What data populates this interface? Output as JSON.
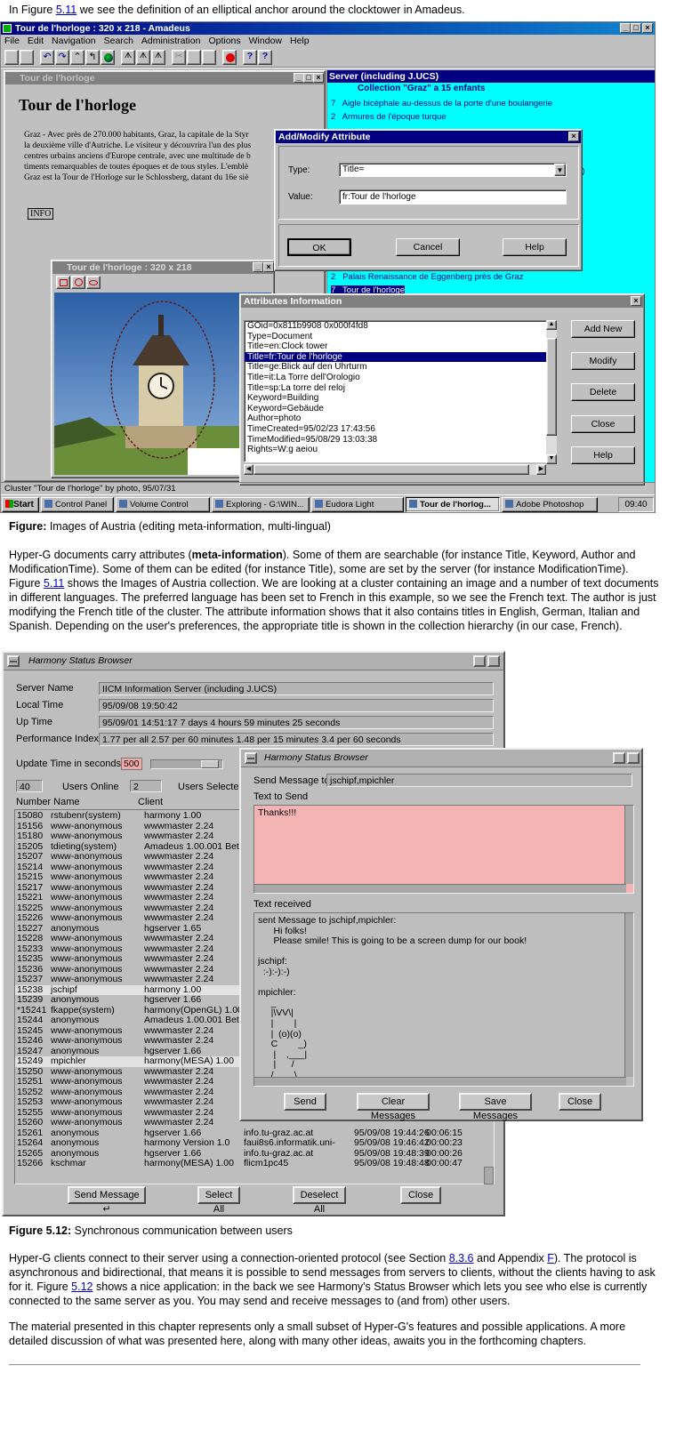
{
  "intro": {
    "before": "In Figure ",
    "link": "5.11",
    "after": " we see the definition of an elliptical anchor around the clocktower in Amadeus."
  },
  "fig1": {
    "title": "Tour de l'horloge :  320 x 218 - Amadeus",
    "menus": [
      "File",
      "Edit",
      "Navigation",
      "Search",
      "Administration",
      "Options",
      "Window",
      "Help"
    ],
    "doc": {
      "title": "Tour de l'horloge",
      "heading": "Tour de l'horloge",
      "lines": [
        "Graz - Avec près de 270.000 habitants, Graz, la capitale de la Styr",
        "la deuxième ville d'Autriche. Le visiteur y découvrira l'un des plus",
        "centres urbains anciens d'Europe centrale, avec une multitude de b",
        "timents remarquables de toutes époques et de tous styles. L'emblè",
        "Graz est la Tour de l'Horloge sur le Schlossberg, datant du 16e siè"
      ],
      "info": "INFO"
    },
    "server": {
      "title": "Server (including J.UCS)",
      "collection": "Collection \"Graz\" a 15 enfants",
      "items": [
        "7   Aigle bicéphale au-dessus de la porte d'une boulangerie",
        "2   Armures de l'époque turque"
      ],
      "partial": "g)",
      "items2": [
        "2   Palais Renaissance de Eggenberg près de Graz",
        "7   Tour de l'horloge"
      ]
    },
    "dialog": {
      "title": "Add/Modify Attribute",
      "type_label": "Type:",
      "type_value": "Title=",
      "value_label": "Value:",
      "value_value": "fr:Tour de l'horloge",
      "ok": "OK",
      "cancel": "Cancel",
      "help": "Help"
    },
    "image_win": {
      "title": "Tour de l'horloge :  320 x 218"
    },
    "attrs": {
      "title": "Attributes Information",
      "items": [
        "GOid=0x811b9908 0x000f4fd8",
        "Type=Document",
        "Title=en:Clock tower",
        "Title=fr:Tour de l'horloge",
        "Title=ge:Blick auf den Uhrturm",
        "Title=it:La Torre dell'Orologio",
        "Title=sp:La torre del reloj",
        "Keyword=Building",
        "Keyword=Gebäude",
        "Author=photo",
        "TimeCreated=95/02/23 17:43:56",
        "TimeModified=95/08/29 13:03:38",
        "Rights=W:g aeiou"
      ],
      "selected": 3,
      "buttons": [
        "Add New",
        "Modify",
        "Delete",
        "Close",
        "Help"
      ]
    },
    "status": "Cluster \"Tour de l'horloge\" by photo, 95/07/31",
    "taskbar": {
      "start": "Start",
      "items": [
        "Control Panel",
        "Volume Control",
        "Exploring - G:\\WIN...",
        "Eudora Light",
        "Tour de l'horlog...",
        "Adobe Photoshop"
      ],
      "active": 4,
      "clock": "09:40"
    }
  },
  "caption1": {
    "bold": "Figure:",
    "text": " Images of Austria (editing meta-information, multi-lingual)"
  },
  "para1": {
    "a": "Hyper-G documents carry attributes (",
    "bold": "meta-information",
    "b": "). Some of them are searchable (for instance Title, Keyword, Author and ModificationTime). Some of them can be edited (for instance Title), some are set by the server (for instance ModificationTime). Figure ",
    "link": "5.11",
    "c": " shows the Images of Austria collection. We are looking at a cluster containing an image and a number of text documents in different languages. The preferred language has been set to French in this example, so we see the French text. The author is just modifying the French title of the cluster. The attribute information shows that it also contains titles in English, German, Italian and Spanish. Depending on the user's preferences, the appropriate title is shown in the collection hierarchy (in our case, French)."
  },
  "fig2": {
    "title": "Harmony Status Browser",
    "fields": [
      {
        "label": "Server Name",
        "value": "IICM Information Server (including J.UCS)"
      },
      {
        "label": "Local Time",
        "value": "95/09/08 19:50:42"
      },
      {
        "label": "Up Time",
        "value": "95/09/01 14:51:17    7 days 4 hours 59 minutes 25 seconds"
      },
      {
        "label": "Performance Index",
        "value": "1.77 per all 2.57 per 60 minutes 1.48 per 15 minutes 3.4 per 60 seconds"
      }
    ],
    "update_label": "Update Time in seconds",
    "update_value": "500",
    "users_online": "40",
    "users_online_label": "Users Online",
    "users_selected": "2",
    "users_selected_label": "Users Selected",
    "col_num": "Number Name",
    "col_client": "Client",
    "users": [
      [
        "15080",
        "rstubenr(system)",
        "harmony 1.00"
      ],
      [
        "15156",
        "www-anonymous",
        "wwwmaster 2.24"
      ],
      [
        "15180",
        "www-anonymous",
        "wwwmaster 2.24"
      ],
      [
        "15205",
        "tdieting(system)",
        "Amadeus 1.00.001 Beta"
      ],
      [
        "15207",
        "www-anonymous",
        "wwwmaster 2.24"
      ],
      [
        "15214",
        "www-anonymous",
        "wwwmaster 2.24"
      ],
      [
        "15215",
        "www-anonymous",
        "wwwmaster 2.24"
      ],
      [
        "15217",
        "www-anonymous",
        "wwwmaster 2.24"
      ],
      [
        "15221",
        "www-anonymous",
        "wwwmaster 2.24"
      ],
      [
        "15225",
        "www-anonymous",
        "wwwmaster 2.24"
      ],
      [
        "15226",
        "www-anonymous",
        "wwwmaster 2.24"
      ],
      [
        "15227",
        "anonymous",
        "hgserver 1.65"
      ],
      [
        "15228",
        "www-anonymous",
        "wwwmaster 2.24"
      ],
      [
        "15233",
        "www-anonymous",
        "wwwmaster 2.24"
      ],
      [
        "15235",
        "www-anonymous",
        "wwwmaster 2.24"
      ],
      [
        "15236",
        "www-anonymous",
        "wwwmaster 2.24"
      ],
      [
        "15237",
        "www-anonymous",
        "wwwmaster 2.24"
      ],
      [
        "15238",
        "jschipf",
        "harmony 1.00"
      ],
      [
        "15239",
        "anonymous",
        "hgserver 1.66"
      ],
      [
        "*15241",
        "fkappe(system)",
        "harmony(OpenGL) 1.00"
      ],
      [
        "15244",
        "anonymous",
        "Amadeus 1.00.001 Beta"
      ],
      [
        "15245",
        "www-anonymous",
        "wwwmaster 2.24"
      ],
      [
        "15246",
        "www-anonymous",
        "wwwmaster 2.24"
      ],
      [
        "15247",
        "anonymous",
        "hgserver 1.66"
      ],
      [
        "15249",
        "mpichler",
        "harmony(MESA) 1.00"
      ],
      [
        "15250",
        "www-anonymous",
        "wwwmaster 2.24"
      ],
      [
        "15251",
        "www-anonymous",
        "wwwmaster 2.24"
      ],
      [
        "15252",
        "www-anonymous",
        "wwwmaster 2.24"
      ],
      [
        "15253",
        "www-anonymous",
        "wwwmaster 2.24"
      ],
      [
        "15255",
        "www-anonymous",
        "wwwmaster 2.24"
      ],
      [
        "15260",
        "www-anonymous",
        "wwwmaster 2.24"
      ],
      [
        "15261",
        "anonymous",
        "hgserver 1.66",
        "info.tu-graz.ac.at",
        "95/09/08  19:44:26",
        "00:06:15"
      ],
      [
        "15264",
        "anonymous",
        "harmony Version 1.0",
        "faui8s6.informatik.uni-",
        "95/09/08  19:46:42",
        "00:00:23"
      ],
      [
        "15265",
        "anonymous",
        "hgserver 1.66",
        "info.tu-graz.ac.at",
        "95/09/08  19:48:39",
        "00:00:26"
      ],
      [
        "15266",
        "kschmar",
        "harmony(MESA) 1.00",
        "flicm1pc45",
        "95/09/08  19:48:48",
        "00:00:47"
      ]
    ],
    "highlight": [
      17,
      24
    ],
    "buttons": [
      "Send Message ↵",
      "Select All",
      "Deselect All",
      "Close"
    ],
    "msg": {
      "title": "Harmony Status Browser",
      "send_to_label": "Send Message to",
      "send_to_value": "jschipf,mpichler",
      "text_to_send_label": "Text to Send",
      "text_to_send": "Thanks!!!",
      "received_label": "Text received",
      "received": [
        "sent Message to jschipf,mpichler:",
        "      Hi folks!",
        "      Please smile! This is going to be a screen dump for our book!",
        "",
        "jschipf:",
        "  :-):-):-)",
        "",
        "mpichler:",
        "     _",
        "     |\\VV\\|",
        "     |        |",
        "     |  (o)(o)",
        "     C        _)",
        "      |    ,___|",
        "      |      /",
        "     /____\\"
      ],
      "buttons": [
        "Send",
        "Clear Messages",
        "Save Messages",
        "Close"
      ]
    }
  },
  "caption2": {
    "bold": "Figure 5.12:",
    "text": " Synchronous communication between users"
  },
  "para2": {
    "a": "Hyper-G clients connect to their server using a connection-oriented protocol (see Section ",
    "link1": "8.3.6",
    "b": " and Appendix ",
    "link2": "F",
    "c": "). The protocol is asynchronous and bidirectional, that means it is possible to send messages from servers to clients, without the clients having to ask for it. Figure ",
    "link3": "5.12",
    "d": " shows a nice application: in the back we see Harmony's Status Browser which lets you see who else is currently connected to the same server as you. You may send and receive messages to (and from) other users."
  },
  "para3": {
    "text": "The material presented in this chapter represents only a small subset of Hyper-G's features and possible applications. A more detailed discussion of what was presented here, along with many other ideas, awaits you in the forthcoming chapters."
  }
}
